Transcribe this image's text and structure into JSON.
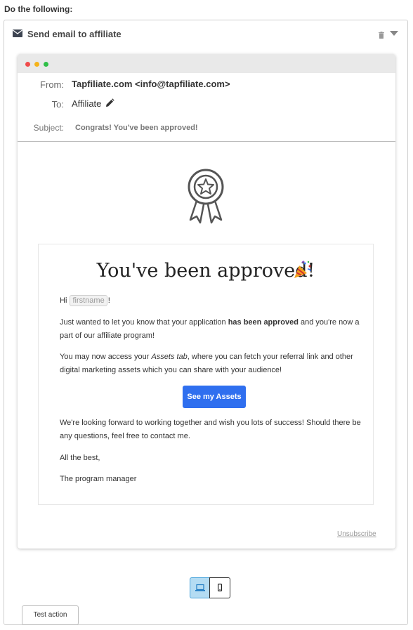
{
  "page": {
    "heading": "Do the following:"
  },
  "action": {
    "title": "Send email to affiliate",
    "icons": {
      "header": "envelope-icon",
      "delete": "trash-icon",
      "toggle": "caret-down-icon"
    }
  },
  "email": {
    "from_label": "From:",
    "from_value": "Tapfiliate.com <info@tapfiliate.com>",
    "to_label": "To:",
    "to_value": "Affiliate",
    "to_edit_icon": "pencil-icon",
    "subject_label": "Subject:",
    "subject_value": "Congrats! You've been approved!",
    "badge_icon": "award-rosette-icon",
    "body": {
      "title": "You've been approved!",
      "title_emoji": "party-popper-icon",
      "greeting_prefix": "Hi",
      "greeting_tag": "firstname",
      "greeting_suffix": "!",
      "p1_start": "Just wanted to let you know that your application ",
      "p1_bold": "has been approved",
      "p1_end": " and you're now a part of our affiliate program!",
      "p2_start": "You may now access your ",
      "p2_italic": "Assets tab",
      "p2_end": ", where you can fetch your referral link and other digital marketing assets which you can share with your audience!",
      "cta_label": "See my Assets",
      "p3": "We're looking forward to working together and wish you lots of success! Should there be any questions, feel free to contact me.",
      "closing": "All the best,",
      "signature": "The program manager"
    },
    "unsubscribe": "Unsubscribe"
  },
  "preview_toggle": {
    "options": [
      "laptop-icon",
      "phone-icon"
    ],
    "selected": "laptop-icon"
  },
  "footer": {
    "test_button": "Test action"
  },
  "colors": {
    "accent": "#2f6fef",
    "toggle_active": "#b4dcf3"
  }
}
